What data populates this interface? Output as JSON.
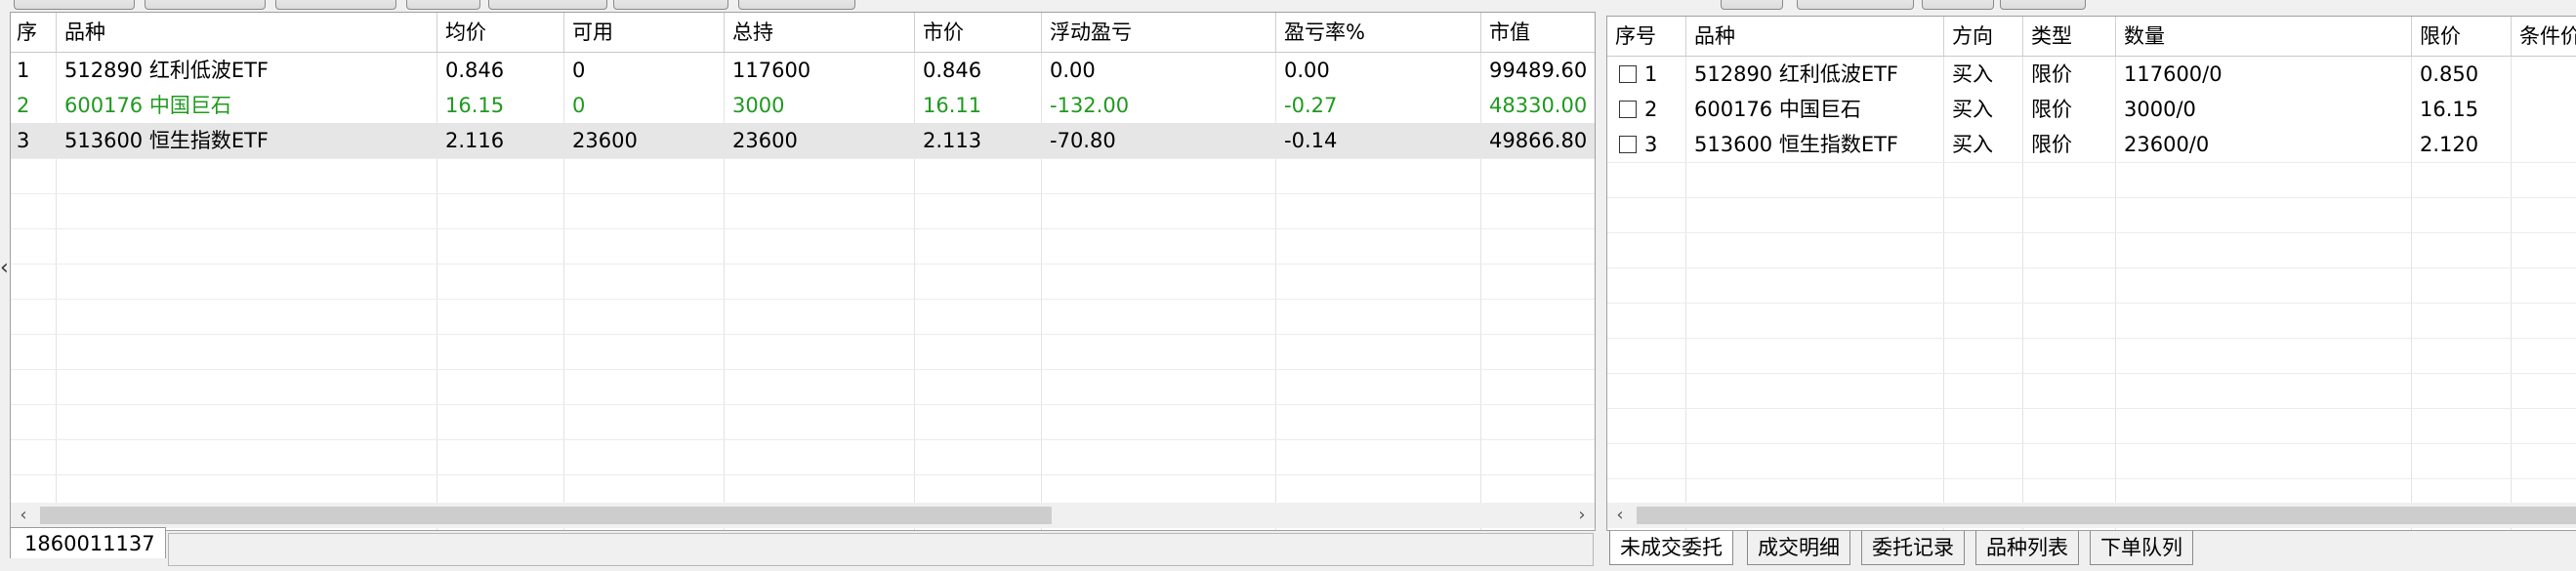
{
  "positions": {
    "columns": [
      "序",
      "品种",
      "均价",
      "可用",
      "总持",
      "市价",
      "浮动盈亏",
      "盈亏率%",
      "市值"
    ],
    "rows": [
      {
        "seq": "1",
        "symbol": "512890 红利低波ETF",
        "avg_price": "0.846",
        "available": "0",
        "total": "117600",
        "market_price": "0.846",
        "float_pnl": "0.00",
        "pnl_rate": "0.00",
        "market_value": "99489.60",
        "highlight": false,
        "selected": false
      },
      {
        "seq": "2",
        "symbol": "600176 中国巨石",
        "avg_price": "16.15",
        "available": "0",
        "total": "3000",
        "market_price": "16.11",
        "float_pnl": "-132.00",
        "pnl_rate": "-0.27",
        "market_value": "48330.00",
        "highlight": true,
        "selected": false
      },
      {
        "seq": "3",
        "symbol": "513600 恒生指数ETF",
        "avg_price": "2.116",
        "available": "23600",
        "total": "23600",
        "market_price": "2.113",
        "float_pnl": "-70.80",
        "pnl_rate": "-0.14",
        "market_value": "49866.80",
        "highlight": false,
        "selected": true
      }
    ]
  },
  "orders": {
    "columns": [
      "序号",
      "品种",
      "方向",
      "类型",
      "数量",
      "限价",
      "条件价"
    ],
    "rows": [
      {
        "seq": "1",
        "symbol": "512890 红利低波ETF",
        "direction": "买入",
        "type": "限价",
        "quantity": "117600/0",
        "limit_price": "0.850",
        "condition_price": ""
      },
      {
        "seq": "2",
        "symbol": "600176 中国巨石",
        "direction": "买入",
        "type": "限价",
        "quantity": "3000/0",
        "limit_price": "16.15",
        "condition_price": ""
      },
      {
        "seq": "3",
        "symbol": "513600 恒生指数ETF",
        "direction": "买入",
        "type": "限价",
        "quantity": "23600/0",
        "limit_price": "2.120",
        "condition_price": ""
      }
    ]
  },
  "account": {
    "id": "1860011137"
  },
  "tabs": [
    {
      "label": "未成交委托",
      "active": true
    },
    {
      "label": "成交明细",
      "active": false
    },
    {
      "label": "委托记录",
      "active": false
    },
    {
      "label": "品种列表",
      "active": false
    },
    {
      "label": "下单队列",
      "active": false
    }
  ],
  "scroll_arrows": {
    "left": "‹",
    "right": "›",
    "side": "‹"
  },
  "colors": {
    "loss_green": "#1f9a1f",
    "selected_row": "#e6e6e6"
  }
}
